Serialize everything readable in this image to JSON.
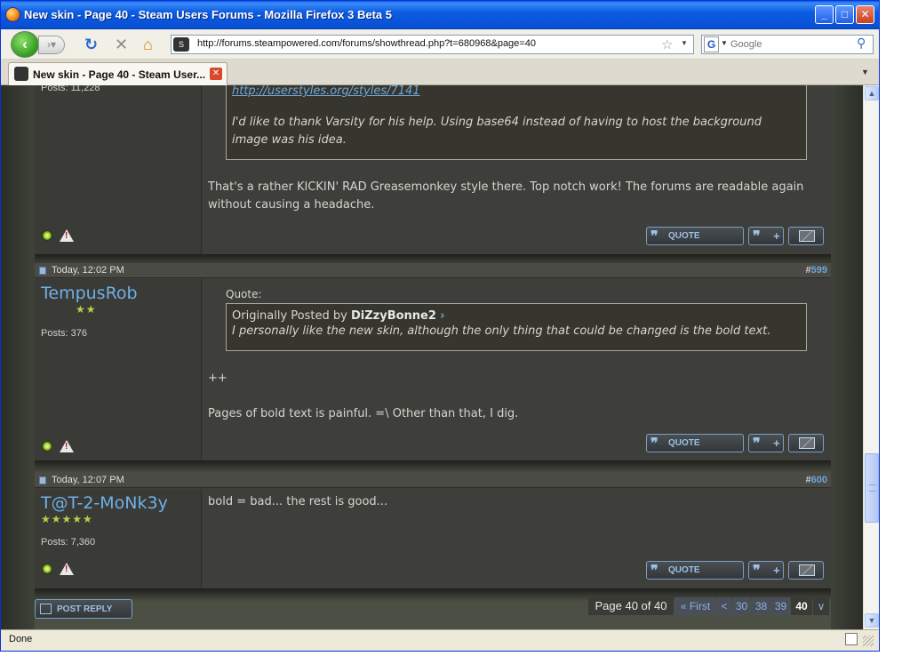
{
  "window": {
    "title": "New skin - Page 40 - Steam Users Forums - Mozilla Firefox 3 Beta 5",
    "min": "_",
    "max": "□",
    "close": "✕"
  },
  "navbar": {
    "url": "http://forums.steampowered.com/forums/showthread.php?t=680968&page=40",
    "search_placeholder": "Google"
  },
  "tab": {
    "label": "New skin - Page 40 - Steam User..."
  },
  "posts": [
    {
      "posts_count": "Posts: 11,228",
      "quote_link": "http://userstyles.org/styles/7141",
      "quote_text": "I'd like to thank Varsity for his help. Using base64 instead of having to host the background image was his idea.",
      "body": "That's a rather KICKIN' RAD Greasemonkey style there. Top notch work! The forums are readable again without causing a headache."
    },
    {
      "date": "Today, 12:02 PM",
      "number_prefix": "#",
      "number": "599",
      "username": "TempusRob",
      "stars": "★★",
      "posts_count": "Posts: 376",
      "quote_label": "Quote:",
      "quote_orig_prefix": "Originally Posted by",
      "quote_author": "DiZzyBonne2",
      "quote_text": "I personally like the new skin, although the only thing that could be changed is the bold text.",
      "body_line1": "++",
      "body_line2": "Pages of bold text is painful. =\\ Other than that, I dig."
    },
    {
      "date": "Today, 12:07 PM",
      "number_prefix": "#",
      "number": "600",
      "username": "T@T-2-MoNk3y",
      "stars": "★★★★★",
      "posts_count": "Posts: 7,360",
      "body": "bold = bad... the rest is good..."
    }
  ],
  "buttons": {
    "quote": "QUOTE",
    "multi_plus": "+",
    "post_reply": "POST REPLY"
  },
  "pagination": {
    "label": "Page 40 of 40",
    "first": "« First",
    "prev": "<",
    "pages": [
      "30",
      "38",
      "39"
    ],
    "current": "40",
    "menu": "∨"
  },
  "statusbar": {
    "status": "Done"
  }
}
